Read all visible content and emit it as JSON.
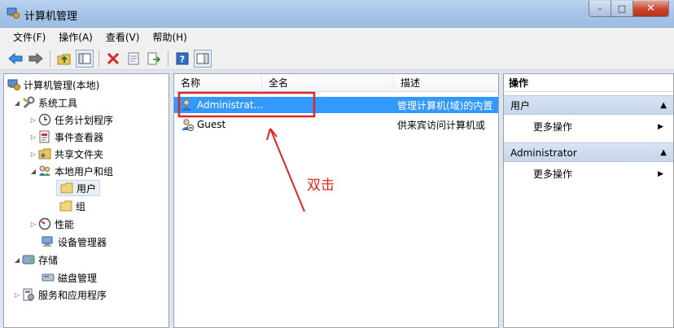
{
  "window": {
    "title": "计算机管理",
    "controls": {
      "minimize": "–",
      "maximize": "□",
      "close": "✕"
    }
  },
  "menu": [
    "文件(F)",
    "操作(A)",
    "查看(V)",
    "帮助(H)"
  ],
  "tree": {
    "items": [
      {
        "label": "计算机管理(本地)",
        "icon": "computer-management-icon",
        "expander": ""
      },
      {
        "label": "系统工具",
        "icon": "system-tools-icon",
        "expander": "◢"
      },
      {
        "label": "任务计划程序",
        "icon": "clock-icon",
        "expander": "▷"
      },
      {
        "label": "事件查看器",
        "icon": "event-viewer-icon",
        "expander": "▷"
      },
      {
        "label": "共享文件夹",
        "icon": "shared-folder-icon",
        "expander": "▷"
      },
      {
        "label": "本地用户和组",
        "icon": "users-icon",
        "expander": "◢"
      },
      {
        "label": "用户",
        "icon": "folder-icon",
        "expander": ""
      },
      {
        "label": "组",
        "icon": "folder-icon",
        "expander": ""
      },
      {
        "label": "性能",
        "icon": "performance-icon",
        "expander": "▷"
      },
      {
        "label": "设备管理器",
        "icon": "device-manager-icon",
        "expander": ""
      },
      {
        "label": "存储",
        "icon": "storage-icon",
        "expander": "◢"
      },
      {
        "label": "磁盘管理",
        "icon": "disk-icon",
        "expander": ""
      },
      {
        "label": "服务和应用程序",
        "icon": "services-icon",
        "expander": "▷"
      }
    ]
  },
  "list": {
    "columns": [
      "名称",
      "全名",
      "描述"
    ],
    "rows": [
      {
        "name": "Administrat...",
        "fullname": "",
        "description": "管理计算机(域)的内置",
        "selected": true
      },
      {
        "name": "Guest",
        "fullname": "",
        "description": "供来宾访问计算机或",
        "selected": false
      }
    ]
  },
  "actions": {
    "header": "操作",
    "sections": [
      {
        "title": "用户",
        "item": "更多操作"
      },
      {
        "title": "Administrator",
        "item": "更多操作"
      }
    ]
  },
  "annotation": {
    "text": "双击",
    "color": "#e0261f"
  },
  "colors": {
    "selection": "#3399ff",
    "titlebar": "#a9c5e8"
  }
}
